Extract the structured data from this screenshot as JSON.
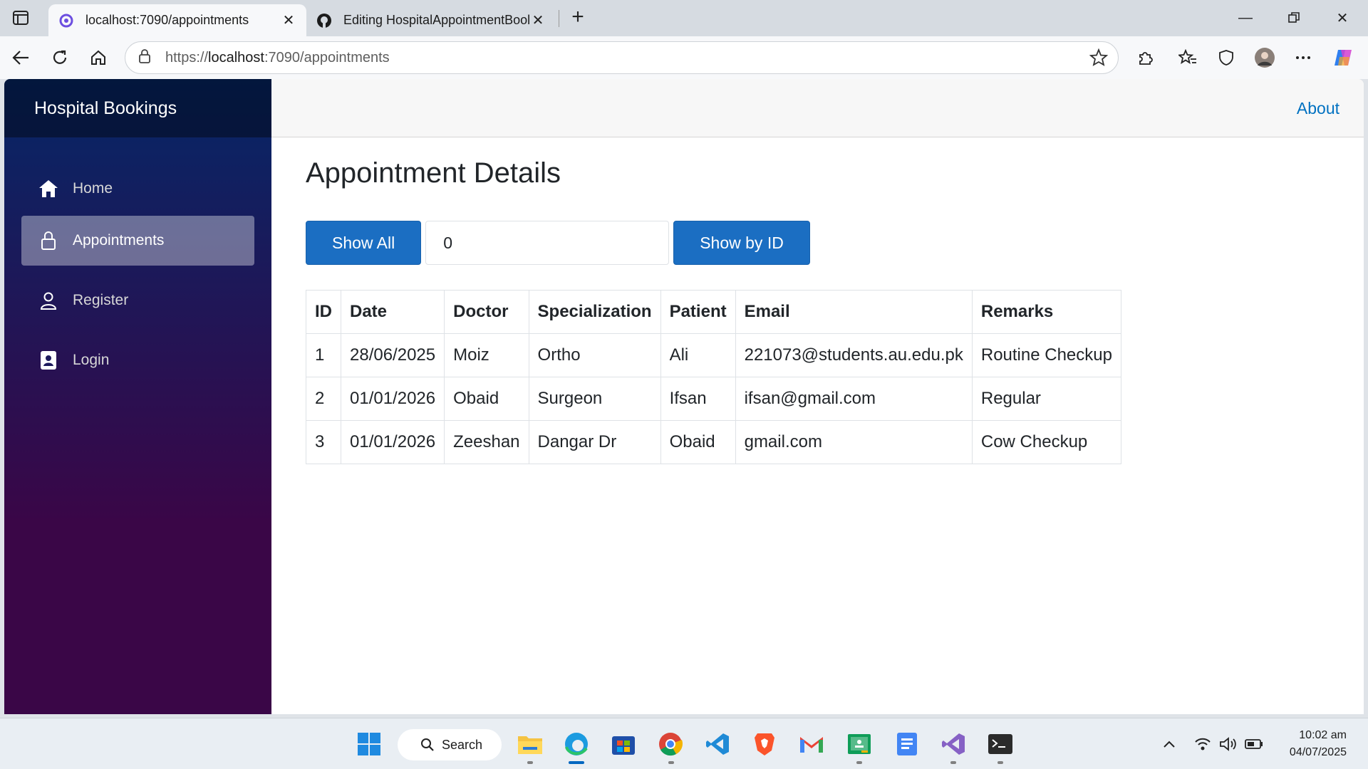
{
  "browser": {
    "tabs": [
      {
        "title": "localhost:7090/appointments",
        "active": true
      },
      {
        "title": "Editing HospitalAppointmentBool",
        "active": false
      }
    ],
    "url_prefix": "https://",
    "url_host": "localhost",
    "url_rest": ":7090/appointments"
  },
  "app": {
    "brand": "Hospital Bookings",
    "about_label": "About",
    "nav": [
      {
        "label": "Home",
        "icon": "home-icon"
      },
      {
        "label": "Appointments",
        "icon": "lock-icon",
        "active": true
      },
      {
        "label": "Register",
        "icon": "person-icon"
      },
      {
        "label": "Login",
        "icon": "badge-icon"
      }
    ]
  },
  "page": {
    "title": "Appointment Details",
    "show_all_label": "Show All",
    "id_value": "0",
    "show_by_id_label": "Show by ID",
    "table": {
      "headers": [
        "ID",
        "Date",
        "Doctor",
        "Specialization",
        "Patient",
        "Email",
        "Remarks"
      ],
      "rows": [
        [
          "1",
          "28/06/2025",
          "Moiz",
          "Ortho",
          "Ali",
          "221073@students.au.edu.pk",
          "Routine Checkup"
        ],
        [
          "2",
          "01/01/2026",
          "Obaid",
          "Surgeon",
          "Ifsan",
          "ifsan@gmail.com",
          "Regular"
        ],
        [
          "3",
          "01/01/2026",
          "Zeeshan",
          "Dangar Dr",
          "Obaid",
          "gmail.com",
          "Cow Checkup"
        ]
      ]
    }
  },
  "taskbar": {
    "search_label": "Search",
    "time": "10:02 am",
    "date": "04/07/2025"
  },
  "colors": {
    "primary_button": "#1b6ec2",
    "link": "#0071c1",
    "sidebar_top": "#052767",
    "sidebar_bottom": "#3a0647"
  }
}
